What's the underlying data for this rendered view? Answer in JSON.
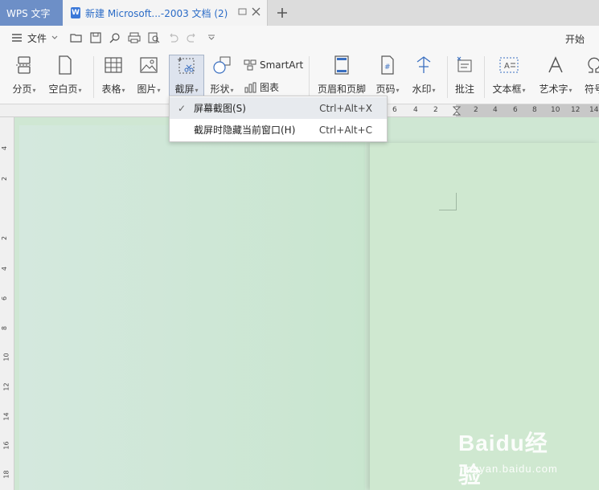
{
  "titlebar": {
    "app_tab": "WPS 文字",
    "doc_tab": "新建 Microsoft...-2003 文档 (2)"
  },
  "menubar": {
    "file_label": "文件",
    "start_label": "开始"
  },
  "ribbon": {
    "pagebreak": "分页",
    "blankpage": "空白页",
    "table": "表格",
    "picture": "图片",
    "screenshot": "截屏",
    "shape": "形状",
    "smartart": "SmartArt",
    "chart": "图表",
    "header_footer": "页眉和页脚",
    "page_number": "页码",
    "watermark": "水印",
    "comment": "批注",
    "textbox": "文本框",
    "wordart": "艺术字",
    "symbol": "符号"
  },
  "ruler": {
    "h_marks": [
      "6",
      "4",
      "2",
      "2",
      "4",
      "6",
      "8",
      "10",
      "12",
      "14"
    ],
    "v_marks": [
      "4",
      "2",
      "2",
      "4",
      "6",
      "8",
      "10",
      "12",
      "14",
      "16",
      "18"
    ]
  },
  "dropdown": {
    "items": [
      {
        "label": "屏幕截图(S)",
        "shortcut": "Ctrl+Alt+X",
        "checked": "✓"
      },
      {
        "label": "截屏时隐藏当前窗口(H)",
        "shortcut": "Ctrl+Alt+C"
      }
    ]
  },
  "watermark": {
    "brand": "Baidu经验",
    "url": "jingyan.baidu.com"
  }
}
